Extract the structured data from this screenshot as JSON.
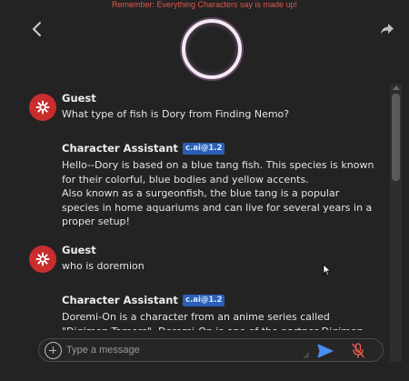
{
  "banner": {
    "text": "Remember: Everything Characters say is made up!"
  },
  "header": {
    "back_icon": "chevron-left-icon",
    "share_icon": "share-icon"
  },
  "messages": [
    {
      "sender": "Guest",
      "text": "What type of fish is Dory from Finding Nemo?",
      "avatar_icon": "asterisk-burst-icon",
      "avatar_color": "#c92d2d"
    },
    {
      "sender": "Character Assistant",
      "badge": "c.ai@1.2",
      "text": "Hello--Dory is based on a blue tang fish. This species is known for their colorful, blue bodies and yellow accents.\nAlso known as a surgeonfish, the blue tang is a popular species in home aquariums and can live for several years in a proper setup!"
    },
    {
      "sender": "Guest",
      "text": "who is doremion",
      "avatar_icon": "asterisk-burst-icon",
      "avatar_color": "#c92d2d"
    },
    {
      "sender": "Character Assistant",
      "badge": "c.ai@1.2",
      "text": "Doremi-On is a character from an anime series called \"Digimon Tamers\". Doremi-On is one of the partner Digimon"
    }
  ],
  "composer": {
    "placeholder": "Type a message",
    "value": "",
    "add_icon": "plus-circle-icon",
    "send_icon": "send-icon",
    "mic_icon": "mic-off-icon"
  },
  "colors": {
    "background": "#232323",
    "banner": "#e0584e",
    "badge": "#2a5fb5",
    "send": "#4a8df0",
    "mic_off": "#e0584e"
  }
}
